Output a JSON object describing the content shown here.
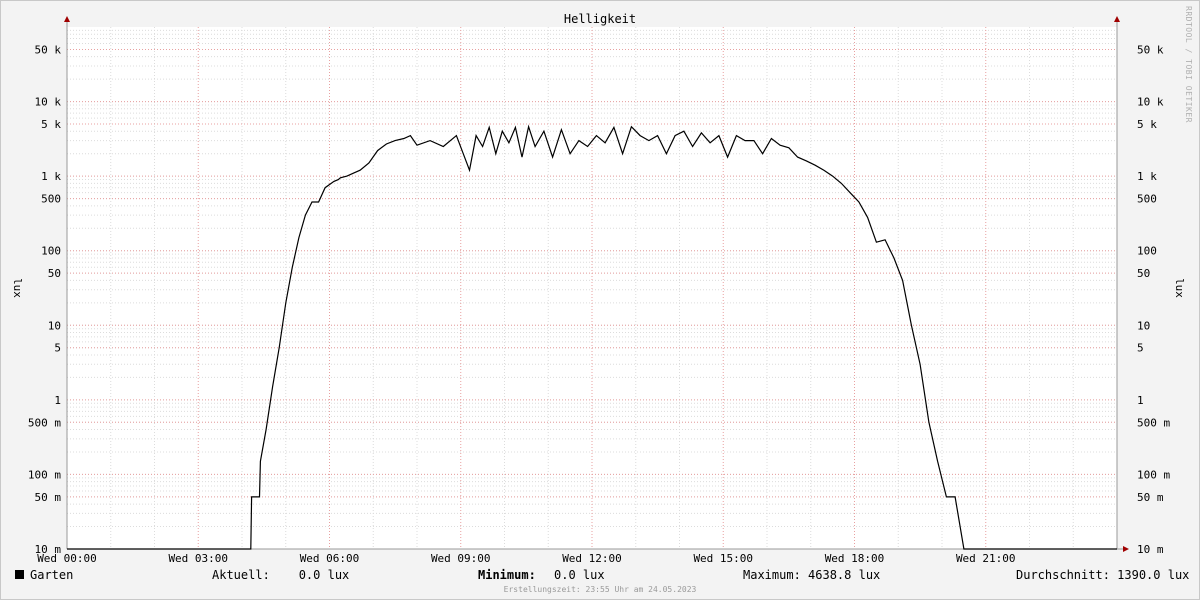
{
  "chart_data": {
    "type": "line",
    "title": "Helligkeit",
    "ylabel": "lux",
    "y_scale": "log",
    "ylim": [
      0.01,
      100000
    ],
    "y_ticks": [
      {
        "value": 50000,
        "label": "50 k"
      },
      {
        "value": 10000,
        "label": "10 k"
      },
      {
        "value": 5000,
        "label": "5 k"
      },
      {
        "value": 1000,
        "label": "1 k"
      },
      {
        "value": 500,
        "label": "500"
      },
      {
        "value": 100,
        "label": "100"
      },
      {
        "value": 50,
        "label": "50"
      },
      {
        "value": 10,
        "label": "10"
      },
      {
        "value": 5,
        "label": "5"
      },
      {
        "value": 1,
        "label": "1"
      },
      {
        "value": 0.5,
        "label": "500 m"
      },
      {
        "value": 0.1,
        "label": "100 m"
      },
      {
        "value": 0.05,
        "label": "50 m"
      },
      {
        "value": 0.01,
        "label": "10 m"
      }
    ],
    "x_unit": "hours",
    "xlim": [
      0,
      24
    ],
    "x_ticks": [
      {
        "value": 0,
        "label": "Wed 00:00"
      },
      {
        "value": 3,
        "label": "Wed 03:00"
      },
      {
        "value": 6,
        "label": "Wed 06:00"
      },
      {
        "value": 9,
        "label": "Wed 09:00"
      },
      {
        "value": 12,
        "label": "Wed 12:00"
      },
      {
        "value": 15,
        "label": "Wed 15:00"
      },
      {
        "value": 18,
        "label": "Wed 18:00"
      },
      {
        "value": 21,
        "label": "Wed 21:00"
      }
    ],
    "grid": true,
    "series": [
      {
        "name": "Garten",
        "color": "#000000",
        "x": [
          0,
          4.2,
          4.22,
          4.4,
          4.42,
          4.55,
          4.7,
          4.85,
          5.0,
          5.15,
          5.3,
          5.45,
          5.6,
          5.75,
          5.9,
          6.1,
          6.2,
          6.25,
          6.4,
          6.55,
          6.7,
          6.9,
          7.1,
          7.3,
          7.5,
          7.7,
          7.85,
          8.0,
          8.3,
          8.6,
          8.9,
          9.2,
          9.35,
          9.5,
          9.65,
          9.8,
          9.95,
          10.1,
          10.25,
          10.4,
          10.55,
          10.7,
          10.9,
          11.1,
          11.3,
          11.5,
          11.7,
          11.9,
          12.1,
          12.3,
          12.5,
          12.7,
          12.9,
          13.1,
          13.3,
          13.5,
          13.7,
          13.9,
          14.1,
          14.3,
          14.5,
          14.7,
          14.9,
          15.1,
          15.3,
          15.5,
          15.7,
          15.9,
          16.1,
          16.3,
          16.5,
          16.7,
          16.9,
          17.1,
          17.3,
          17.5,
          17.7,
          17.9,
          18.1,
          18.3,
          18.5,
          18.7,
          18.9,
          19.1,
          19.3,
          19.5,
          19.7,
          19.9,
          20.1,
          20.3,
          20.5,
          20.7,
          20.85,
          21.0,
          21.15,
          21.3,
          21.45,
          21.6,
          21.75,
          21.9,
          22.05,
          22.15,
          22.3,
          22.35,
          22.6,
          22.62,
          24
        ],
        "values": [
          0.01,
          0.01,
          0.05,
          0.05,
          0.15,
          0.4,
          1.5,
          5,
          20,
          60,
          150,
          300,
          450,
          450,
          700,
          850,
          900,
          950,
          1000,
          1100,
          1200,
          1500,
          2200,
          2700,
          3000,
          3200,
          3500,
          2600,
          3000,
          2500,
          3500,
          1200,
          3500,
          2500,
          4500,
          2000,
          4000,
          2800,
          4500,
          1800,
          4600,
          2500,
          4000,
          1800,
          4200,
          2000,
          3000,
          2500,
          3500,
          2800,
          4500,
          2000,
          4600,
          3500,
          3000,
          3500,
          2000,
          3500,
          4000,
          2500,
          3800,
          2800,
          3500,
          1800,
          3500,
          3000,
          3000,
          2000,
          3200,
          2600,
          2400,
          1800,
          1600,
          1400,
          1200,
          1000,
          800,
          600,
          450,
          280,
          130,
          140,
          80,
          40,
          10,
          3,
          0.5,
          0.15,
          0.05,
          0.05,
          0.01,
          0.01,
          0.01,
          0.01,
          0.01,
          0.01,
          0.01,
          0.01,
          0.01,
          0.01,
          0.01,
          0.01,
          0.01,
          0.01,
          0.01,
          0.01,
          0.01
        ]
      }
    ]
  },
  "legend": {
    "series_name": "Garten",
    "current": "Aktuell:    0.0 lux",
    "minimum_label": "Minimum:",
    "minimum_value": "0.0 lux",
    "maximum": "Maximum: 4638.8 lux",
    "average": "Durchschnitt: 1390.0 lux"
  },
  "footer": "Erstellungszeit: 23:55 Uhr am 24.05.2023",
  "watermark": "RRDTOOL / TOBI OETIKER"
}
